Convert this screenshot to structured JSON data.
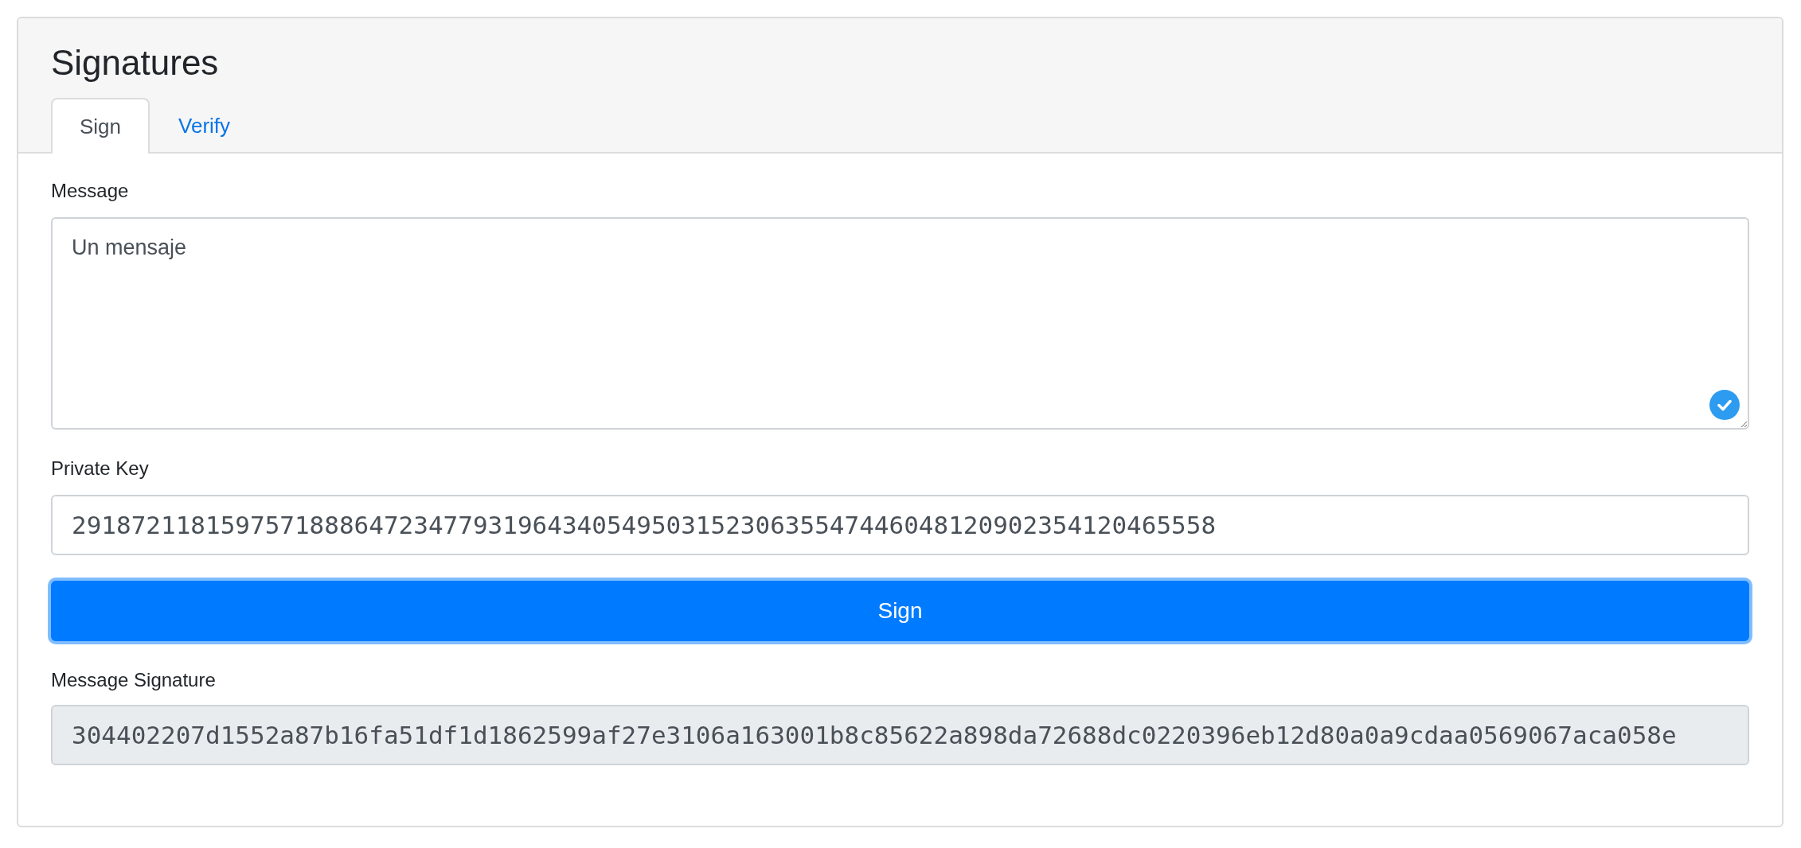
{
  "title": "Signatures",
  "tabs": [
    {
      "label": "Sign",
      "selected": true
    },
    {
      "label": "Verify",
      "selected": false
    }
  ],
  "form": {
    "message": {
      "label": "Message",
      "value": "Un mensaje"
    },
    "private_key": {
      "label": "Private Key",
      "value": "29187211815975718886472347793196434054950315230635547446048120902354120465558"
    },
    "sign_button": "Sign",
    "signature": {
      "label": "Message Signature",
      "value": "304402207d1552a87b16fa51df1d1862599af27e3106a163001b8c85622a898da72688dc0220396eb12d80a0a9cdaa0569067aca058e"
    }
  }
}
